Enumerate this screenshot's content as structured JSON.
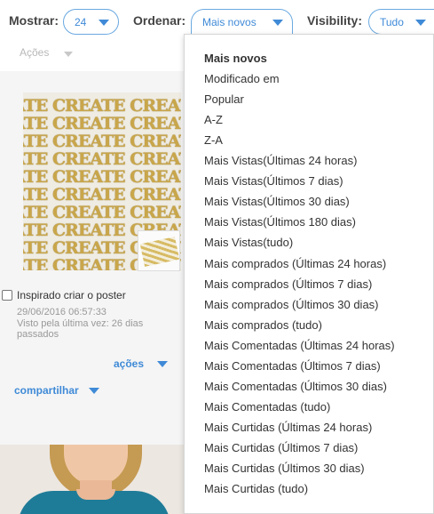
{
  "toolbar": {
    "show_label": "Mostrar:",
    "show_value": "24",
    "sort_label": "Ordenar:",
    "sort_value": "Mais novos",
    "visibility_label": "Visibility:",
    "visibility_value": "Tudo"
  },
  "actions_top": "Ações",
  "product": {
    "pattern_text": "ATE CREATE CREATE CREATE",
    "title": "Inspirado criar o poster",
    "date": "29/06/2016 06:57:33",
    "visto": "Visto pela última vez: 26 dias passados",
    "checked": false
  },
  "links": {
    "actions": "ações",
    "share": "compartilhar"
  },
  "sort_menu": {
    "items": [
      "Mais novos",
      "Modificado em",
      "Popular",
      "A-Z",
      "Z-A",
      "Mais Vistas(Últimas 24 horas)",
      "Mais Vistas(Últimos 7 dias)",
      "Mais Vistas(Últimos 30 dias)",
      "Mais Vistas(Últimos 180 dias)",
      "Mais Vistas(tudo)",
      "Mais comprados (Últimas 24 horas)",
      "Mais comprados (Últimos 7 dias)",
      "Mais comprados (Últimos 30 dias)",
      "Mais comprados (tudo)",
      "Mais Comentadas (Últimas 24 horas)",
      "Mais Comentadas (Últimos 7 dias)",
      "Mais Comentadas (Últimos 30 dias)",
      "Mais Comentadas (tudo)",
      "Mais Curtidas (Últimas 24 horas)",
      "Mais Curtidas (Últimos 7 dias)",
      "Mais Curtidas (Últimos 30 dias)",
      "Mais Curtidas (tudo)"
    ],
    "selected": "Mais novos"
  },
  "colors": {
    "accent": "#3f8ad7",
    "pill_border": "#6aa9e0",
    "panel_bg": "#f5f5f5",
    "pattern_gold": "#c9a64a"
  }
}
